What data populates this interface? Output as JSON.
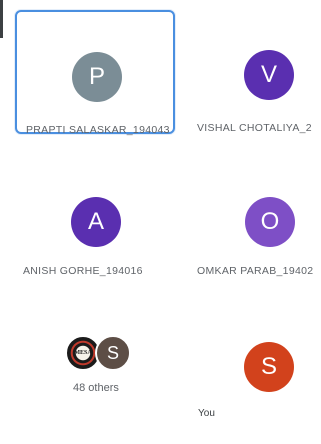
{
  "participants": [
    {
      "initial": "P",
      "name": "PRAPTI SALASKAR_194043",
      "color": "#7b8d96",
      "focused": true
    },
    {
      "initial": "V",
      "name": "VISHAL CHOTALIYA_2",
      "color": "#5a2fb0",
      "focused": false
    },
    {
      "initial": "A",
      "name": "ANISH GORHE_194016",
      "color": "#5a2fb0",
      "focused": false
    },
    {
      "initial": "O",
      "name": "OMKAR PARAB_19402",
      "color": "#7e4fc6",
      "focused": false
    }
  ],
  "others_group": {
    "logo_text": "MESA",
    "mini_initial": "S",
    "label": "48 others"
  },
  "self": {
    "initial": "S",
    "label": "You",
    "color": "#d2421c"
  }
}
